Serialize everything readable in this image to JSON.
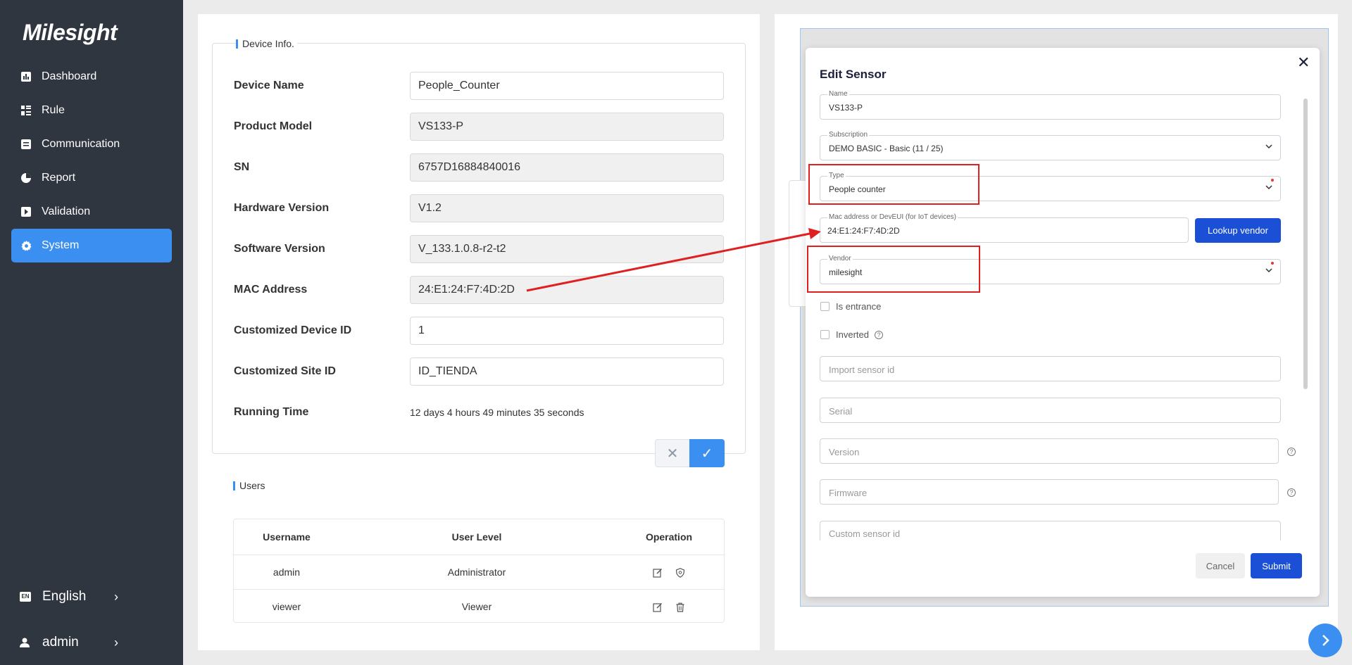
{
  "sidebar": {
    "logo": "Milesight",
    "items": [
      {
        "label": "Dashboard",
        "icon": "dashboard-icon"
      },
      {
        "label": "Rule",
        "icon": "rule-icon"
      },
      {
        "label": "Communication",
        "icon": "communication-icon"
      },
      {
        "label": "Report",
        "icon": "report-icon"
      },
      {
        "label": "Validation",
        "icon": "validation-icon"
      },
      {
        "label": "System",
        "icon": "gear-icon",
        "active": true
      }
    ],
    "language": {
      "badge": "EN",
      "label": "English"
    },
    "user": {
      "label": "admin"
    }
  },
  "device_info": {
    "legend": "Device Info.",
    "fields": [
      {
        "label": "Device Name",
        "value": "People_Counter",
        "editable": true
      },
      {
        "label": "Product Model",
        "value": "VS133-P",
        "editable": false
      },
      {
        "label": "SN",
        "value": "6757D16884840016",
        "editable": false
      },
      {
        "label": "Hardware Version",
        "value": "V1.2",
        "editable": false
      },
      {
        "label": "Software Version",
        "value": "V_133.1.0.8-r2-t2",
        "editable": false
      },
      {
        "label": "MAC Address",
        "value": "24:E1:24:F7:4D:2D",
        "editable": false
      },
      {
        "label": "Customized Device ID",
        "value": "1",
        "editable": true
      },
      {
        "label": "Customized Site ID",
        "value": "ID_TIENDA",
        "editable": true
      }
    ],
    "running_time": {
      "label": "Running Time",
      "value": "12 days 4 hours 49 minutes 35 seconds"
    }
  },
  "users": {
    "legend": "Users",
    "columns": [
      "Username",
      "User Level",
      "Operation"
    ],
    "rows": [
      {
        "username": "admin",
        "level": "Administrator",
        "ops": [
          "edit-icon",
          "shield-icon"
        ]
      },
      {
        "username": "viewer",
        "level": "Viewer",
        "ops": [
          "edit-icon",
          "trash-icon"
        ]
      }
    ]
  },
  "modal": {
    "title": "Edit Sensor",
    "name": {
      "label": "Name",
      "value": "VS133-P"
    },
    "subscription": {
      "label": "Subscription",
      "value": "DEMO BASIC - Basic (11 / 25)"
    },
    "type": {
      "label": "Type",
      "value": "People counter"
    },
    "mac": {
      "label": "Mac address or DevEUI (for IoT devices)",
      "value": "24:E1:24:F7:4D:2D"
    },
    "lookup_button": "Lookup vendor",
    "vendor": {
      "label": "Vendor",
      "value": "milesight"
    },
    "is_entrance": "Is entrance",
    "inverted": "Inverted",
    "placeholders": {
      "import_sensor_id": "Import sensor id",
      "serial": "Serial",
      "version": "Version",
      "firmware": "Firmware",
      "custom_sensor_id": "Custom sensor id"
    },
    "cancel": "Cancel",
    "submit": "Submit"
  },
  "colors": {
    "accent": "#3b8ff0",
    "sidebar": "#2f3640",
    "modal_button": "#1a4fd6",
    "highlight": "#e02020"
  }
}
